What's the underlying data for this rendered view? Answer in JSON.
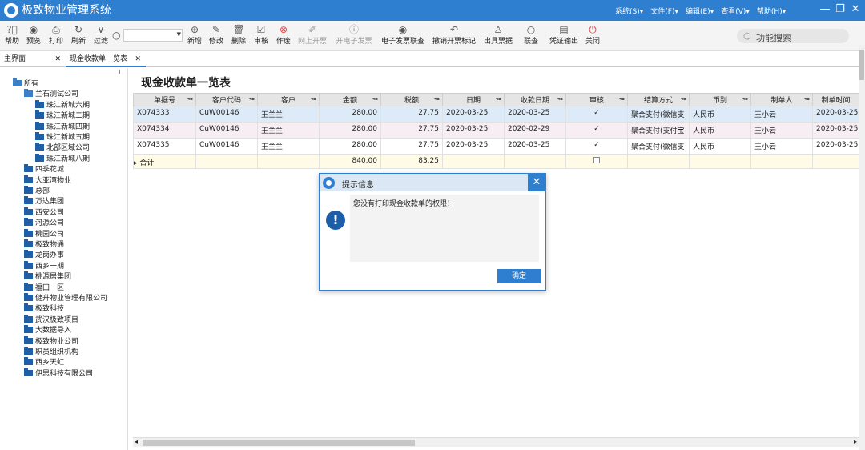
{
  "app": {
    "title": "极致物业管理系统",
    "menus": [
      "系统(S)▾",
      "文件(F)▾",
      "编辑(E)▾",
      "查看(V)▾",
      "帮助(H)▾"
    ]
  },
  "toolbar": {
    "help": "帮助",
    "preview": "预览",
    "print": "打印",
    "refresh": "刷新",
    "filter": "过滤",
    "add": "新增",
    "edit": "修改",
    "delete": "删除",
    "audit": "审核",
    "void": "作废",
    "online_invoice": "网上开票",
    "e_invoice": "开电子发票",
    "e_invoice_query": "电子发票联查",
    "cancel_invoice_mark": "撤销开票标记",
    "issue_bill": "出具票据",
    "link_query": "联查",
    "voucher_output": "凭证输出",
    "close": "关闭",
    "func_search": "功能搜索"
  },
  "tabs": {
    "home": "主界面",
    "list": "现金收款单一览表",
    "close": "✕"
  },
  "tree": {
    "items": [
      "所有",
      "兰石测试公司",
      "珠江新城六期",
      "珠江新城二期",
      "珠江新城四期",
      "珠江新城五期",
      "北部区域公司",
      "珠江新城八期",
      "四季花城",
      "大亚湾物业",
      "总部",
      "万达集团",
      "西安公司",
      "河源公司",
      "桃园公司",
      "极致物通",
      "龙岗办事",
      "西乡一期",
      "桃源居集团",
      "福田一区",
      "健升物业管理有限公司",
      "极致科技",
      "武汉极致项目",
      "大数据导入",
      "极致物业公司",
      "职员组织机构",
      "西乡天虹",
      "伊思科技有限公司"
    ]
  },
  "page": {
    "title": "现金收款单一览表"
  },
  "table": {
    "headers": [
      "单据号",
      "客户代码",
      "客户",
      "金额",
      "税额",
      "日期",
      "收款日期",
      "审核",
      "结算方式",
      "币别",
      "制单人",
      "制单时间"
    ],
    "rows": [
      [
        "X074333",
        "CuW00146",
        "王兰兰",
        "280.00",
        "27.75",
        "2020-03-25",
        "2020-03-25",
        "✓",
        "聚合支付(微信支",
        "人民币",
        "王小云",
        "2020-03-25"
      ],
      [
        "X074334",
        "CuW00146",
        "王兰兰",
        "280.00",
        "27.75",
        "2020-03-25",
        "2020-02-29",
        "✓",
        "聚合支付(支付宝",
        "人民币",
        "王小云",
        "2020-03-25"
      ],
      [
        "X074335",
        "CuW00146",
        "王兰兰",
        "280.00",
        "27.75",
        "2020-03-25",
        "2020-03-25",
        "✓",
        "聚合支付(微信支",
        "人民币",
        "王小云",
        "2020-03-25"
      ]
    ],
    "total": {
      "label": "合计",
      "amount": "840.00",
      "tax": "83.25"
    }
  },
  "dialog": {
    "title": "提示信息",
    "message": "您没有打印现金收款单的权限！",
    "ok": "确定"
  },
  "colors": {
    "accent": "#2f7fd0",
    "folder": "#1f5fa6"
  }
}
